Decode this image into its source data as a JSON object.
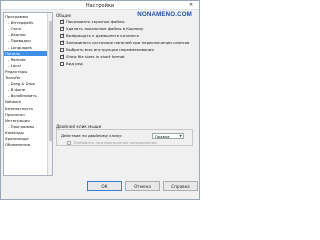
{
  "window": {
    "title": "Настройки",
    "close_glyph": "✕",
    "watermark": "NONAMENO.COM"
  },
  "tree": {
    "items": [
      {
        "label": "Программа"
      },
      {
        "label": "- Интерфейс"
      },
      {
        "label": "- Окно"
      },
      {
        "label": "- Иконки"
      },
      {
        "label": "- Приводки"
      },
      {
        "label": "- Languages"
      },
      {
        "label": "Панель",
        "selected": true
      },
      {
        "label": "- Remote"
      },
      {
        "label": "- Local"
      },
      {
        "label": "Редакторы"
      },
      {
        "label": "Transfer"
      },
      {
        "label": "- Drag & Drop"
      },
      {
        "label": "- В фоне"
      },
      {
        "label": "- Возобновить"
      },
      {
        "label": "Network"
      },
      {
        "label": "Безопасность"
      },
      {
        "label": "Протокол"
      },
      {
        "label": "Интеграция"
      },
      {
        "label": "- Программы"
      },
      {
        "label": "Команды"
      },
      {
        "label": "Хранилище"
      },
      {
        "label": "Обновления"
      }
    ]
  },
  "general": {
    "group_label": "Общие",
    "options": [
      {
        "label": "Показывать скрытые файлы",
        "checked": true
      },
      {
        "label": "Удалять локальные файлы в Корзину",
        "checked": true
      },
      {
        "label": "Возвращать к домашнего каталога",
        "checked": true
      },
      {
        "label": "Запоминать состояние панелей при переключении сеансов",
        "checked": true
      },
      {
        "label": "Выбрать всю инструкция переименования",
        "checked": false
      },
      {
        "label": "Show file sizes in short format",
        "checked": true
      },
      {
        "label": "Вид ред",
        "checked": false
      }
    ]
  },
  "double_click": {
    "group_label": "Двойной клик мыши",
    "action_label": "Действие по двойному клику:",
    "action_value": "Правка",
    "confirm_label": "Требовать подтверждение копирования",
    "confirm_checked": false
  },
  "buttons": {
    "ok": "ОК",
    "cancel": "Отмена",
    "help": "Справка"
  }
}
